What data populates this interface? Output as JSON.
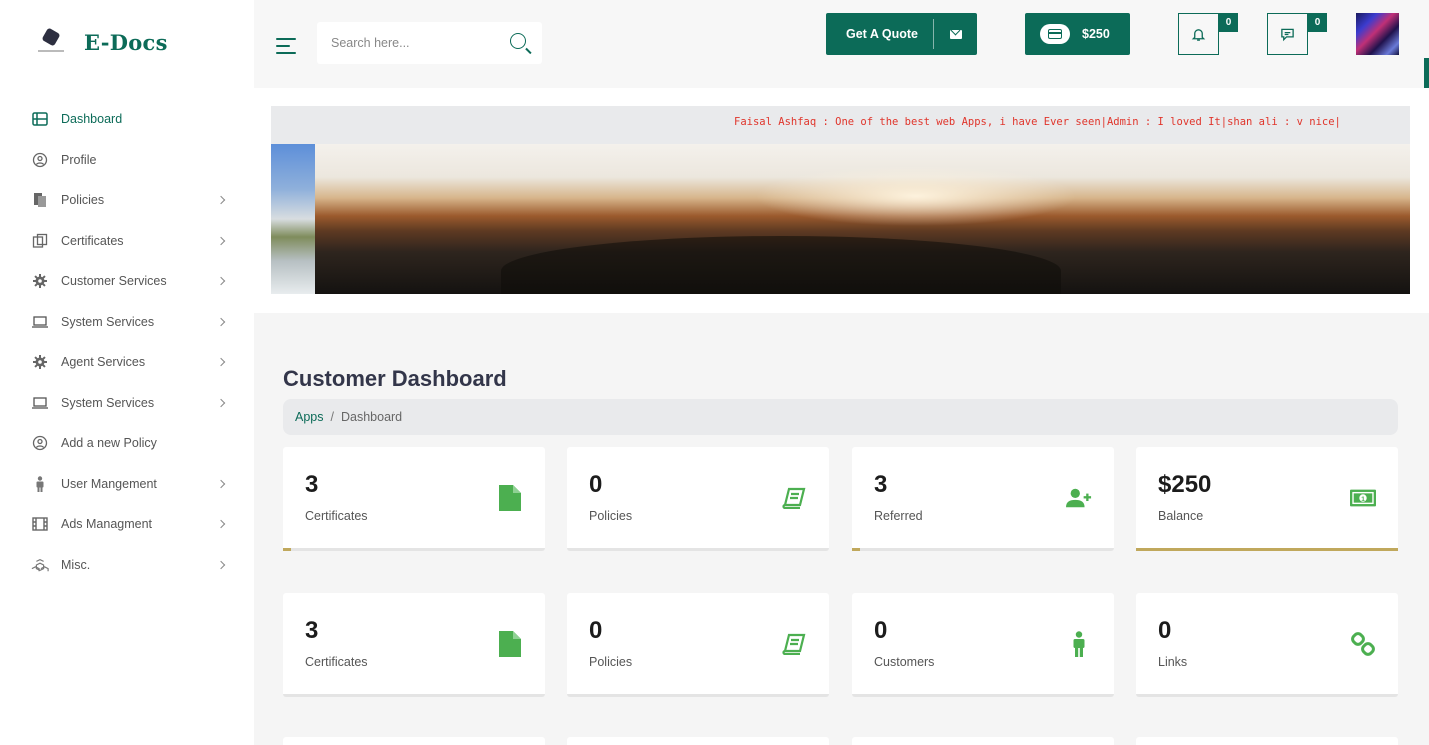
{
  "app": {
    "logo_text": "E-Docs"
  },
  "sidebar": {
    "items": [
      {
        "label": "Dashboard",
        "icon": "dashboard-icon",
        "active": true,
        "chevron": false
      },
      {
        "label": "Profile",
        "icon": "profile-icon",
        "active": false,
        "chevron": false
      },
      {
        "label": "Policies",
        "icon": "policies-icon",
        "active": false,
        "chevron": true
      },
      {
        "label": "Certificates",
        "icon": "certificates-icon",
        "active": false,
        "chevron": true
      },
      {
        "label": "Customer Services",
        "icon": "gear-icon",
        "active": false,
        "chevron": true
      },
      {
        "label": "System Services",
        "icon": "laptop-icon",
        "active": false,
        "chevron": true
      },
      {
        "label": "Agent Services",
        "icon": "gear-icon",
        "active": false,
        "chevron": true
      },
      {
        "label": "System Services",
        "icon": "laptop-icon",
        "active": false,
        "chevron": true
      },
      {
        "label": "Add a new Policy",
        "icon": "profile-icon",
        "active": false,
        "chevron": false
      },
      {
        "label": "User Mangement",
        "icon": "user-icon",
        "active": false,
        "chevron": true
      },
      {
        "label": "Ads Managment",
        "icon": "film-icon",
        "active": false,
        "chevron": true
      },
      {
        "label": "Misc.",
        "icon": "cubes-icon",
        "active": false,
        "chevron": true
      }
    ]
  },
  "topbar": {
    "search_placeholder": "Search here...",
    "quote_label": "Get A Quote",
    "wallet_label": "$250",
    "notifications_count": "0",
    "messages_count": "0"
  },
  "banner": {
    "ticker_text": "Faisal Ashfaq : One of the best web Apps, i have Ever seen|Admin : I loved It|shan ali : v nice|"
  },
  "main": {
    "title": "Customer Dashboard",
    "breadcrumb": {
      "root": "Apps",
      "separator": "/",
      "current": "Dashboard"
    },
    "row1": [
      {
        "value": "3",
        "label": "Certificates",
        "icon": "file-icon",
        "progress": 0.03
      },
      {
        "value": "0",
        "label": "Policies",
        "icon": "book-icon",
        "progress": 0
      },
      {
        "value": "3",
        "label": "Referred",
        "icon": "user-plus-icon",
        "progress": 0.03
      },
      {
        "value": "$250",
        "label": "Balance",
        "icon": "money-icon",
        "progress": 1
      }
    ],
    "row2": [
      {
        "value": "3",
        "label": "Certificates",
        "icon": "file-icon"
      },
      {
        "value": "0",
        "label": "Policies",
        "icon": "book-icon"
      },
      {
        "value": "0",
        "label": "Customers",
        "icon": "person-icon"
      },
      {
        "value": "0",
        "label": "Links",
        "icon": "link-icon"
      }
    ]
  },
  "colors": {
    "brand": "#0c6b58",
    "icon_green": "#4caf50",
    "progress_gold": "#c0a85c",
    "ticker_red": "#e0352b"
  }
}
